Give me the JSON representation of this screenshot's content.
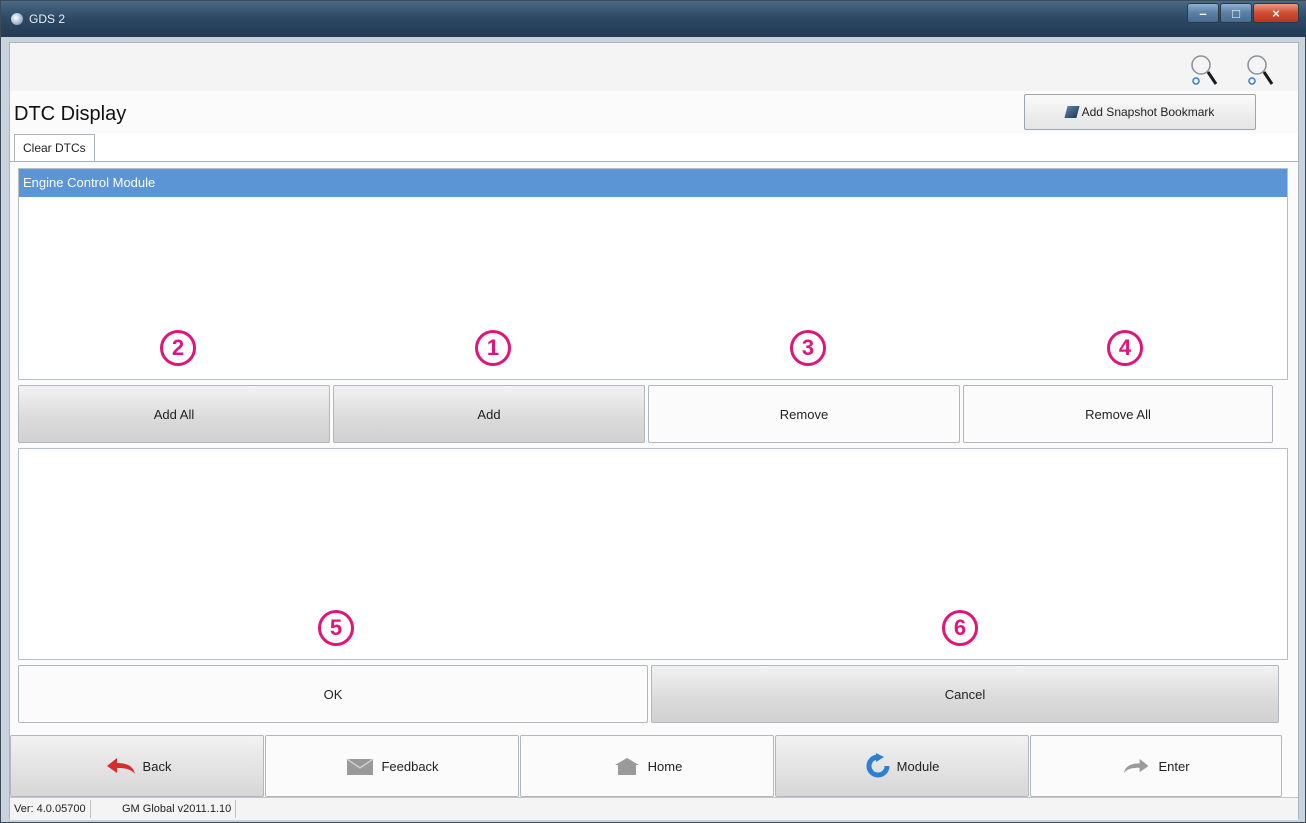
{
  "window": {
    "title": "GDS 2"
  },
  "header": {
    "page_title": "DTC Display",
    "snapshot_button": "Add Snapshot Bookmark"
  },
  "tabs": [
    {
      "label": "Clear DTCs"
    }
  ],
  "module_list": {
    "selected_item": "Engine Control Module"
  },
  "transfer_buttons": {
    "add_all": "Add All",
    "add": "Add",
    "remove": "Remove",
    "remove_all": "Remove All"
  },
  "dialog_buttons": {
    "ok": "OK",
    "cancel": "Cancel"
  },
  "annotations": {
    "add_all": "2",
    "add": "1",
    "remove": "3",
    "remove_all": "4",
    "ok": "5",
    "cancel": "6"
  },
  "nav": {
    "back": "Back",
    "feedback": "Feedback",
    "home": "Home",
    "module": "Module",
    "enter": "Enter"
  },
  "status": {
    "version": "Ver: 4.0.05700",
    "data_version": "GM Global v2011.1.10"
  },
  "colors": {
    "selection": "#5b95d6",
    "annotation": "#e0147a"
  }
}
